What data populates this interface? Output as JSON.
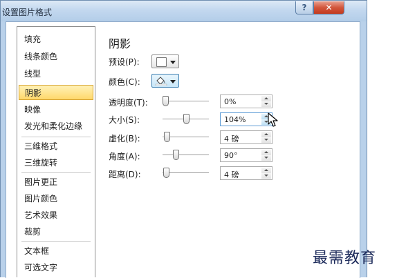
{
  "window": {
    "title": "设置图片格式",
    "help_label": "?",
    "close_label": "✕"
  },
  "nav": {
    "items": [
      {
        "label": "填充"
      },
      {
        "label": "线条颜色"
      },
      {
        "label": "线型"
      },
      {
        "label": "阴影",
        "selected": true
      },
      {
        "label": "映像"
      },
      {
        "label": "发光和柔化边缘"
      },
      {
        "label": "三维格式"
      },
      {
        "label": "三维旋转"
      },
      {
        "label": "图片更正"
      },
      {
        "label": "图片颜色"
      },
      {
        "label": "艺术效果"
      },
      {
        "label": "裁剪"
      },
      {
        "label": "文本框"
      },
      {
        "label": "可选文字"
      }
    ]
  },
  "shadow": {
    "title": "阴影",
    "preset_label": "预设(P):",
    "color_label": "颜色(C):",
    "color_value": "#ffffff",
    "transparency": {
      "label": "透明度(T):",
      "value": "0%",
      "fraction": 0.0
    },
    "size": {
      "label": "大小(S):",
      "value": "104%",
      "fraction": 0.52
    },
    "blur": {
      "label": "虚化(B):",
      "value": "4 磅",
      "fraction": 0.04
    },
    "angle": {
      "label": "角度(A):",
      "value": "90°",
      "fraction": 0.25
    },
    "distance": {
      "label": "距离(D):",
      "value": "4 磅",
      "fraction": 0.02
    }
  },
  "watermark": "最需教育",
  "colors": {
    "selected_bg": "#ffd86b",
    "title_bar": "#c3d8ef",
    "close_red": "#c23a1f",
    "focus_blue": "#5b9bd5"
  }
}
